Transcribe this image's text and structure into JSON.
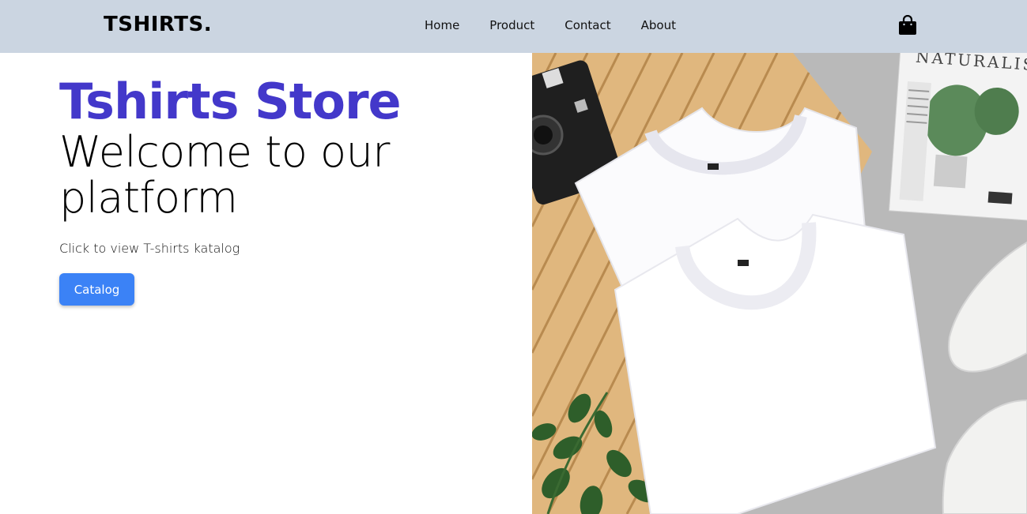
{
  "nav": {
    "logo": "TSHIRTS.",
    "links": [
      "Home",
      "Product",
      "Contact",
      "About"
    ],
    "cart_icon": "shopping-bag-icon"
  },
  "hero": {
    "title": "Tshirts Store",
    "subtitle": "Welcome to our platform",
    "description": "Click to view T-shirts katalog",
    "button_label": "Catalog"
  },
  "image": {
    "magazine_text": "NATURALIS"
  },
  "colors": {
    "navbar_bg": "#cbd5e1",
    "title": "#4338ca",
    "button": "#3b82f6"
  }
}
